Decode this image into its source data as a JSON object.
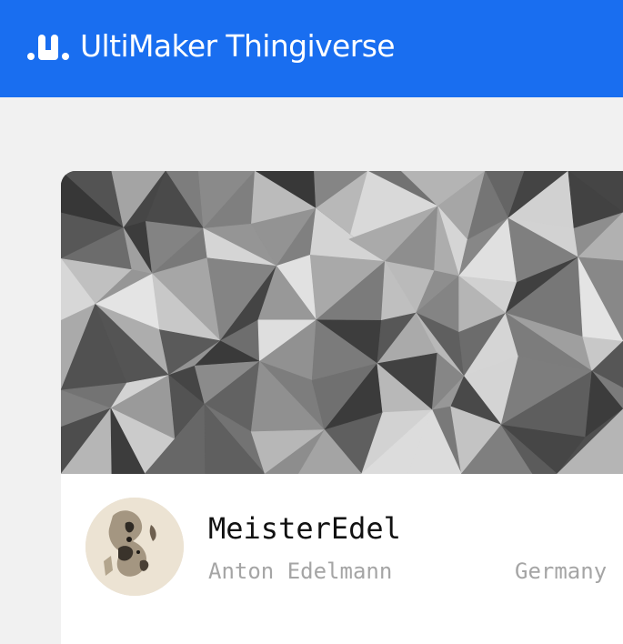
{
  "header": {
    "brand_name": "UltiMaker Thingiverse",
    "brand_icon": "ultimaker-logo-icon",
    "background_color": "#196ef0"
  },
  "profile": {
    "username": "MeisterEdel",
    "full_name": "Anton Edelmann",
    "location": "Germany",
    "avatar_icon": "user-avatar",
    "cover_icon": "cover-image"
  }
}
